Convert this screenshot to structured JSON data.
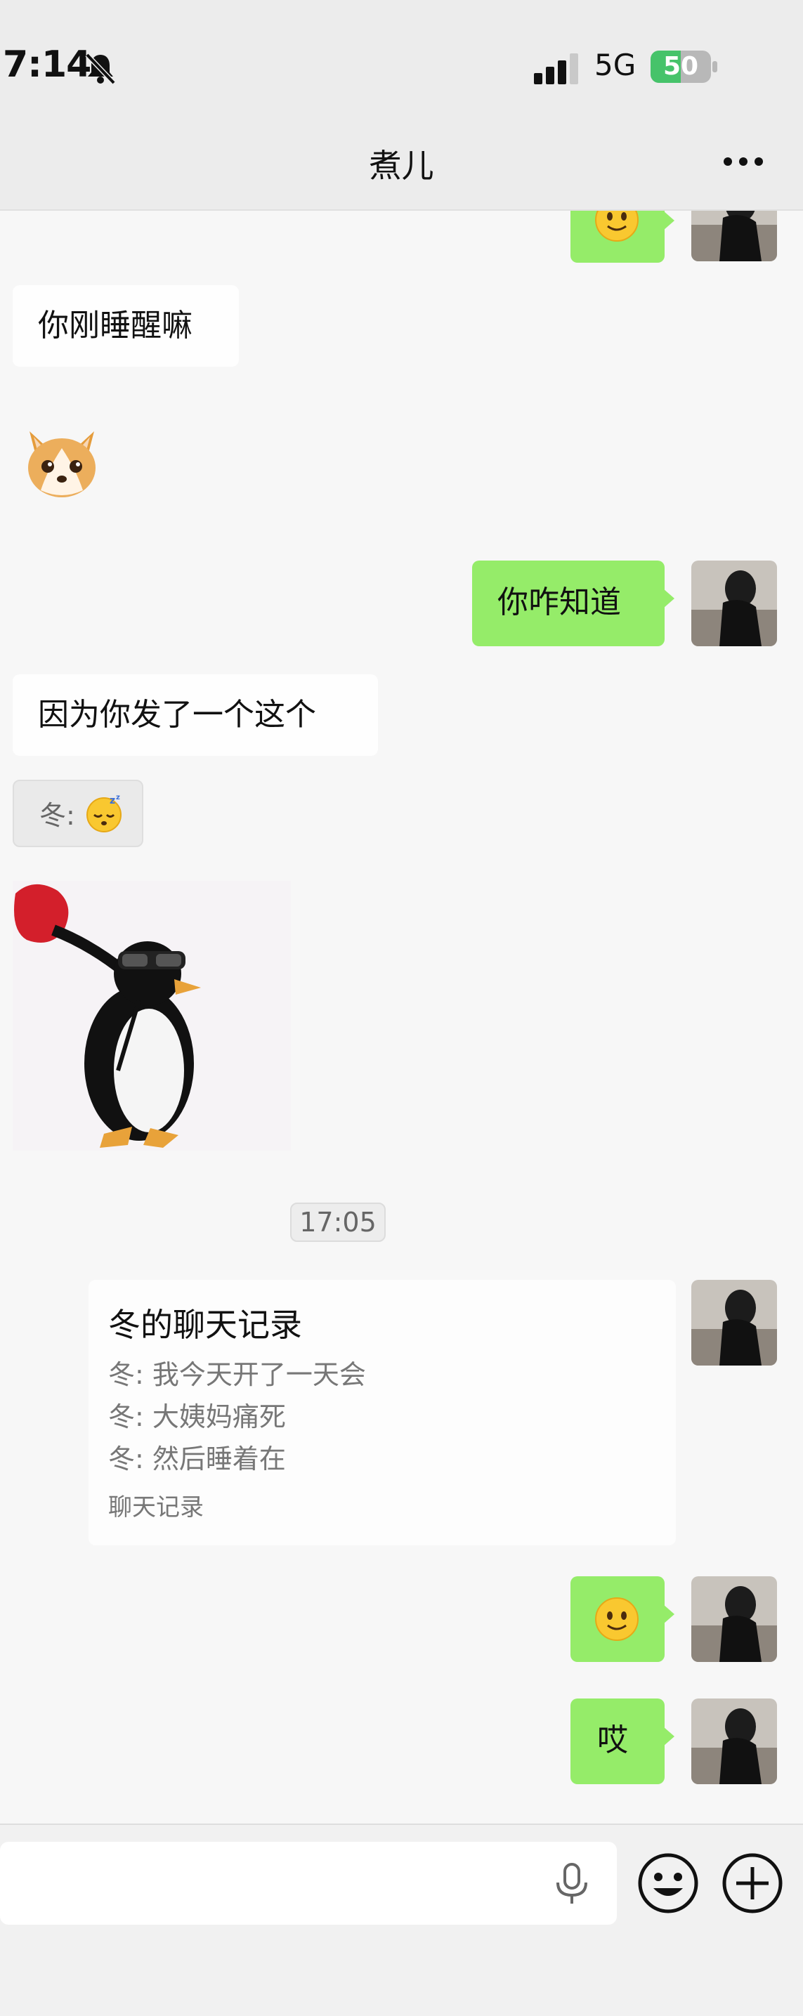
{
  "status_bar": {
    "time": "7:14",
    "network": "5G",
    "battery_percent": "50",
    "battery_level": 0.5,
    "battery_color": "#46c36a"
  },
  "nav": {
    "title": "煮儿",
    "more_icon": "more-dots-icon"
  },
  "messages": [
    {
      "side": "out",
      "type": "emoji",
      "content": "smiling-face-emoji"
    },
    {
      "side": "in",
      "type": "text",
      "text": "你刚睡醒嘛"
    },
    {
      "side": "in",
      "type": "sticker",
      "content": "corgi-sticker"
    },
    {
      "side": "out",
      "type": "text",
      "text": "你咋知道"
    },
    {
      "side": "in",
      "type": "text",
      "text": "因为你发了一个这个"
    },
    {
      "side": "in",
      "type": "quote",
      "prefix": "冬:",
      "content": "sleeping-face-emoji"
    },
    {
      "side": "in",
      "type": "sticker",
      "content": "penguin-sunglasses-sticker"
    },
    {
      "type": "timestamp",
      "text": "17:05"
    },
    {
      "side": "out",
      "type": "chat_record",
      "title": "冬的聊天记录",
      "lines": [
        "冬: 我今天开了一天会",
        "冬: 大姨妈痛死",
        "冬: 然后睡着在"
      ],
      "footer": "聊天记录"
    },
    {
      "side": "out",
      "type": "emoji",
      "content": "smiling-face-emoji"
    },
    {
      "side": "out",
      "type": "text",
      "text": "哎"
    }
  ],
  "input_bar": {
    "mic_icon": "microphone-icon",
    "emoji_icon": "emoji-face-icon",
    "plus_icon": "plus-circle-icon"
  },
  "colors": {
    "outgoing_bubble": "#95ec69",
    "incoming_bubble": "#ffffff",
    "background": "#f7f7f7"
  }
}
